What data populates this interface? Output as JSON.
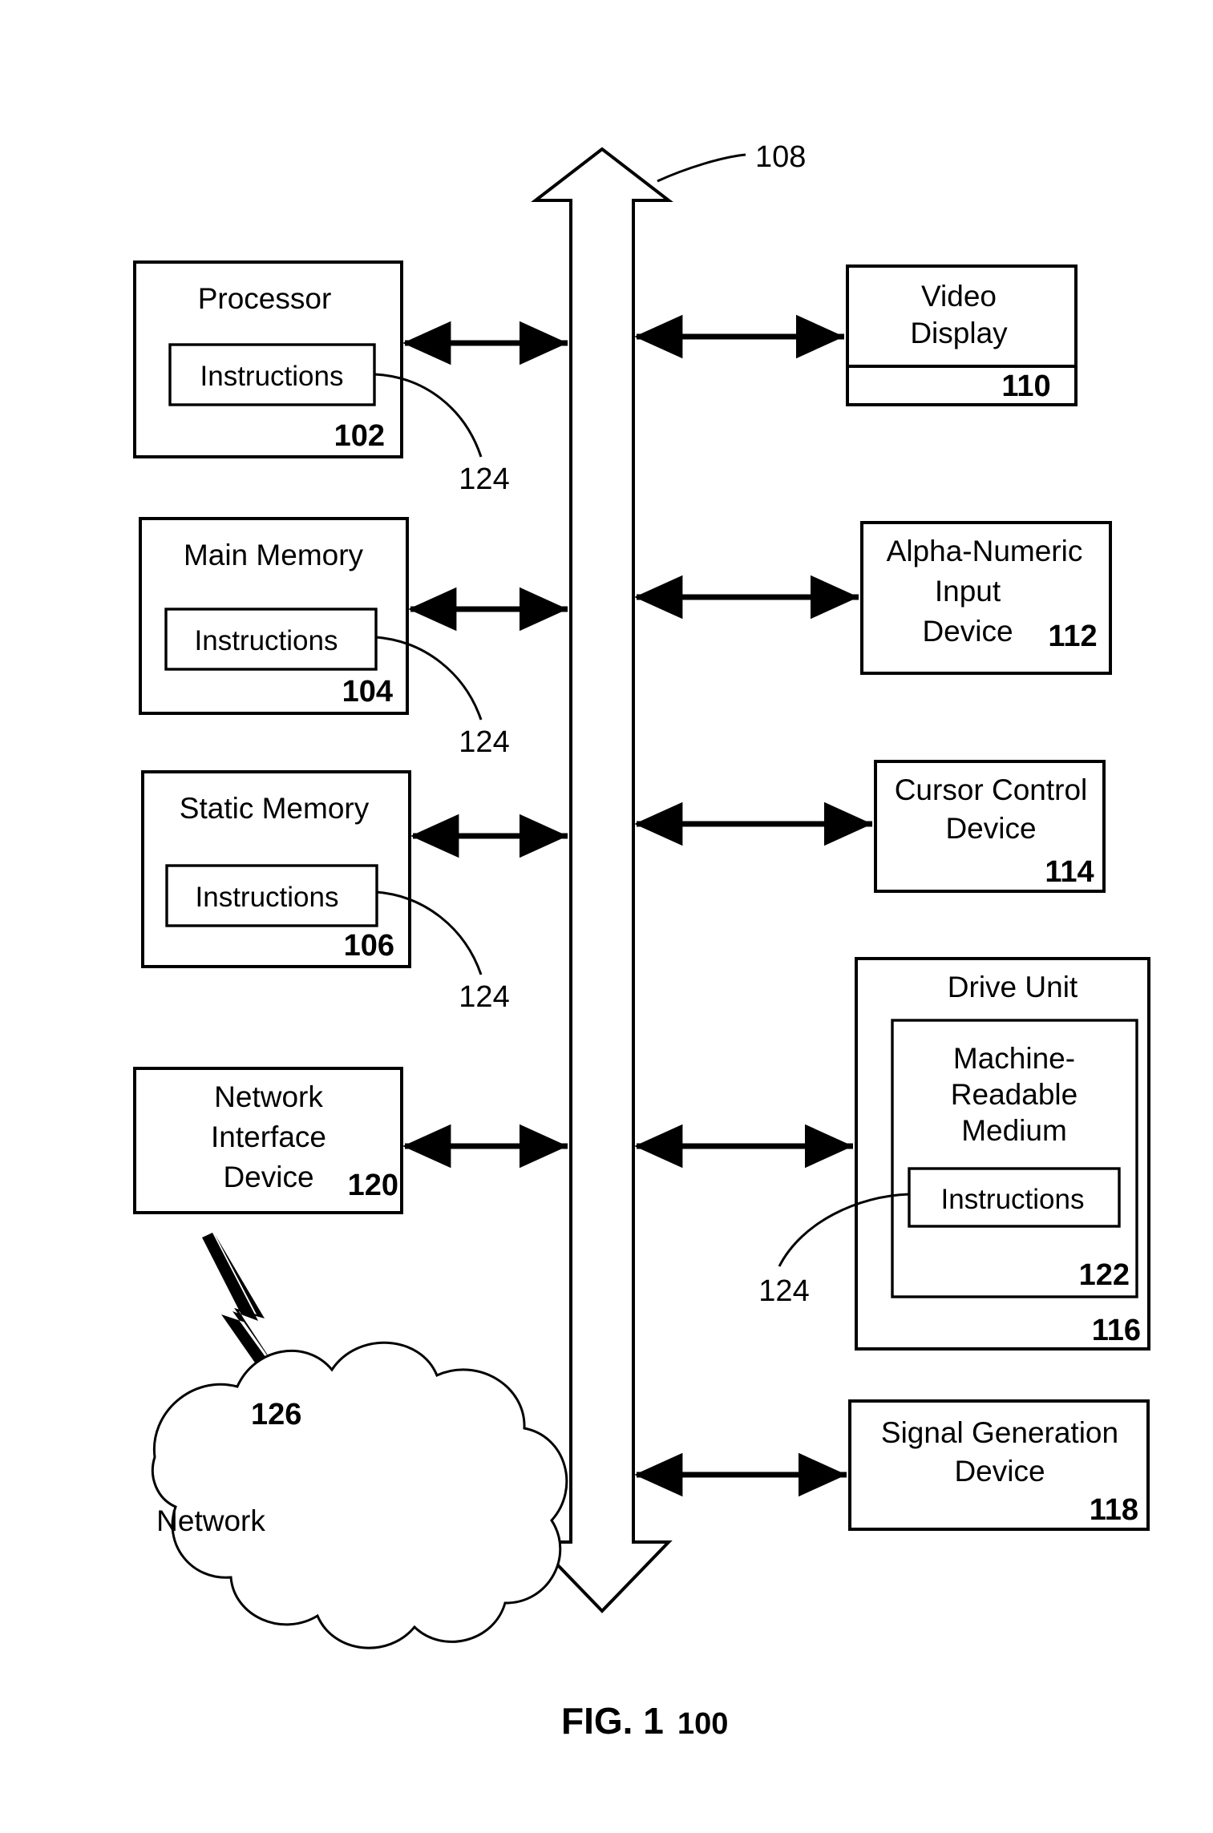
{
  "figure": {
    "caption_label": "FIG. 1",
    "caption_ref": "100"
  },
  "bus": {
    "name": "bus",
    "ref": "108"
  },
  "left_column": [
    {
      "title": "Processor",
      "ref": "102",
      "inner_label": "Instructions",
      "inner_ref": "124"
    },
    {
      "title": "Main Memory",
      "ref": "104",
      "inner_label": "Instructions",
      "inner_ref": "124"
    },
    {
      "title": "Static Memory",
      "ref": "106",
      "inner_label": "Instructions",
      "inner_ref": "124"
    },
    {
      "title_line1": "Network",
      "title_line2": "Interface",
      "title_line3": "Device",
      "ref": "120"
    }
  ],
  "right_column": [
    {
      "title_line1": "Video",
      "title_line2": "Display",
      "ref": "110"
    },
    {
      "title_line1": "Alpha-Numeric",
      "title_line2": "Input",
      "title_line3": "Device",
      "ref": "112"
    },
    {
      "title_line1": "Cursor Control",
      "title_line2": "Device",
      "ref": "114"
    },
    {
      "title": "Drive Unit",
      "ref": "116",
      "medium": {
        "title_line1": "Machine-",
        "title_line2": "Readable",
        "title_line3": "Medium",
        "ref": "122",
        "inner_label": "Instructions",
        "inner_ref": "124"
      }
    },
    {
      "title_line1": "Signal Generation",
      "title_line2": "Device",
      "ref": "118"
    }
  ],
  "network": {
    "label": "Network",
    "ref": "126"
  }
}
